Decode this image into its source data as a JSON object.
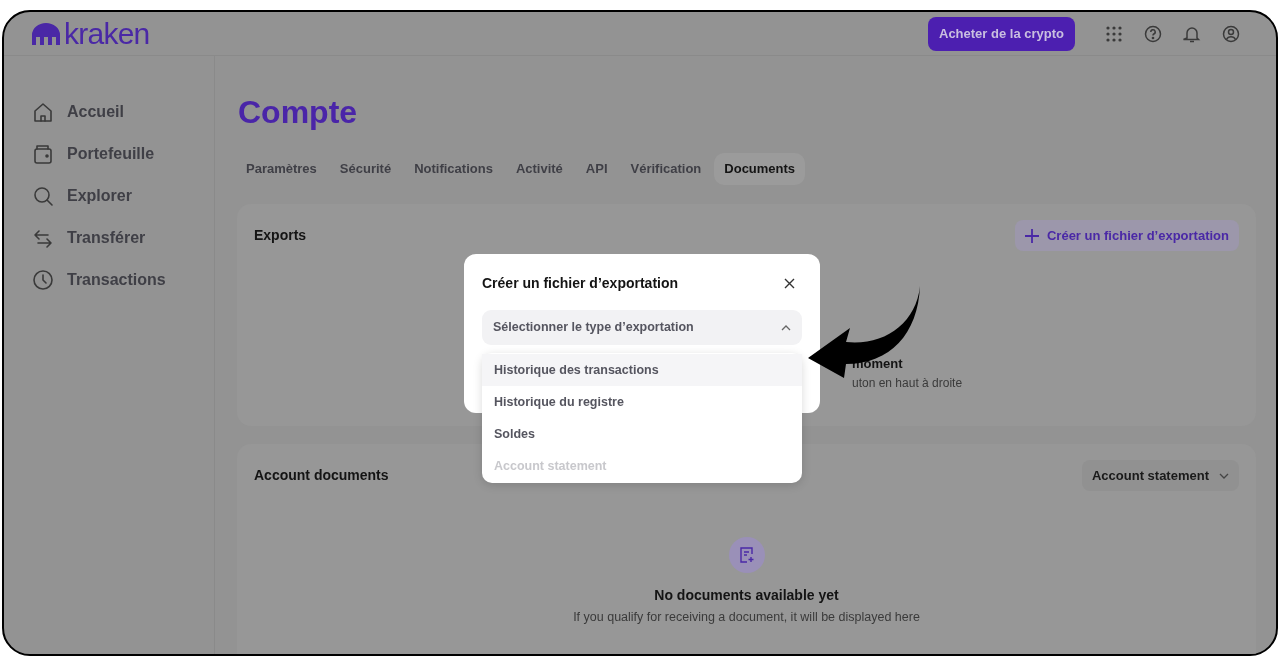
{
  "header": {
    "logo": "kraken",
    "buy_button": "Acheter de la crypto"
  },
  "sidebar": {
    "items": [
      {
        "label": "Accueil"
      },
      {
        "label": "Portefeuille"
      },
      {
        "label": "Explorer"
      },
      {
        "label": "Transférer"
      },
      {
        "label": "Transactions"
      }
    ]
  },
  "page_title": "Compte",
  "tabs": [
    {
      "label": "Paramètres",
      "selected": false
    },
    {
      "label": "Sécurité",
      "selected": false
    },
    {
      "label": "Notifications",
      "selected": false
    },
    {
      "label": "Activité",
      "selected": false
    },
    {
      "label": "API",
      "selected": false
    },
    {
      "label": "Vérification",
      "selected": false
    },
    {
      "label": "Documents",
      "selected": true
    }
  ],
  "exports_card": {
    "title": "Exports",
    "create_button": "Créer un fichier d’exportation",
    "empty_title_fragment": "moment",
    "empty_text_fragment": "uton en haut à droite"
  },
  "account_documents": {
    "title": "Account documents",
    "filter": "Account statement",
    "empty_title": "No documents available yet",
    "empty_text": "If you qualify for receiving a document, it will be displayed here"
  },
  "modal": {
    "title": "Créer un fichier d’exportation",
    "select": {
      "placeholder": "Sélectionner le type d’exportation",
      "expanded": true,
      "options": [
        {
          "label": "Historique des transactions",
          "highlighted": true,
          "disabled": false
        },
        {
          "label": "Historique du registre",
          "highlighted": false,
          "disabled": false
        },
        {
          "label": "Soldes",
          "highlighted": false,
          "disabled": false
        },
        {
          "label": "Account statement",
          "highlighted": false,
          "disabled": true
        }
      ]
    }
  }
}
